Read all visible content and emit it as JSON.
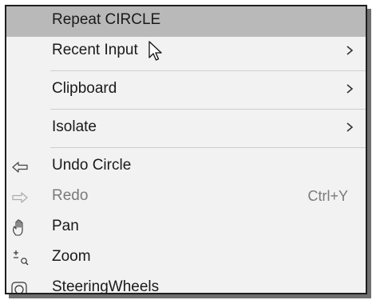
{
  "menu": {
    "items": [
      {
        "label": "Repeat CIRCLE"
      },
      {
        "label": "Recent Input",
        "submenu_icon": "chevron-right-icon"
      },
      {
        "label": "Clipboard",
        "submenu_icon": "chevron-right-icon"
      },
      {
        "label": "Isolate",
        "submenu_icon": "chevron-right-icon"
      },
      {
        "label": "Undo Circle",
        "icon": "undo-arrow-icon"
      },
      {
        "label": "Redo",
        "shortcut": "Ctrl+Y",
        "icon": "redo-arrow-icon",
        "state": "disabled"
      },
      {
        "label": "Pan",
        "icon": "hand-pan-icon"
      },
      {
        "label": "Zoom",
        "icon": "zoom-plus-minus-icon"
      },
      {
        "label": "SteeringWheels",
        "icon": "steering-wheel-icon"
      }
    ]
  },
  "colors": {
    "highlight_background": "#b9b9b9",
    "menu_background": "#f2f2f2",
    "text": "#1a1a1a",
    "disabled_text": "#7a7a7a",
    "border": "#1f1f1f"
  },
  "cursor": {
    "icon": "mouse-pointer-icon"
  }
}
